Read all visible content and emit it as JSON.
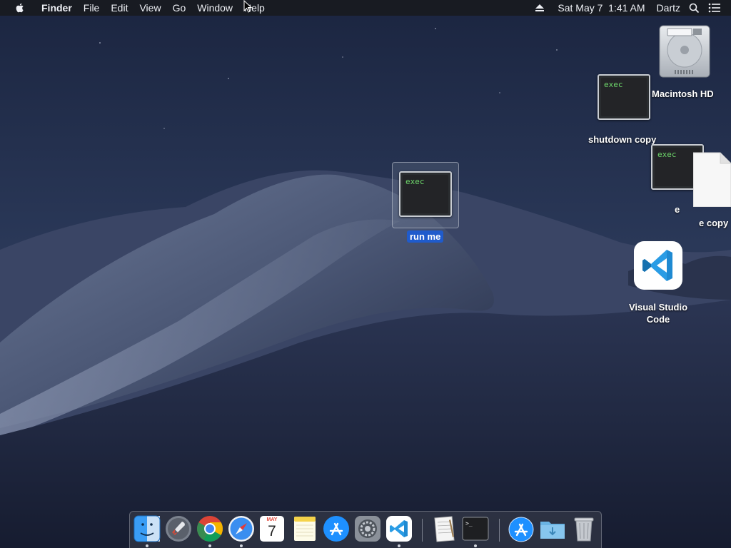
{
  "menubar": {
    "app_name": "Finder",
    "menus": [
      "File",
      "Edit",
      "View",
      "Go",
      "Window",
      "Help"
    ],
    "clock": "Sat May 7  1:41 AM",
    "user": "Dartz",
    "icons": [
      "apple-icon",
      "eject-icon",
      "spotlight-search-icon",
      "notification-center-icon"
    ]
  },
  "desktop": {
    "items": [
      {
        "label": "Macintosh HD",
        "icon": "hard-drive-icon"
      },
      {
        "label": "shutdown copy",
        "icon": "unix-executable-icon",
        "badge": "exec"
      },
      {
        "label": "e",
        "icon": "unix-executable-icon",
        "badge": "exec"
      },
      {
        "label": "e copy",
        "icon": "blank-document-icon"
      },
      {
        "label": "run me",
        "icon": "unix-executable-icon",
        "badge": "exec",
        "selected": true
      },
      {
        "label": "Visual Studio Code",
        "label_lines": [
          "Visual Studio",
          "Code"
        ],
        "icon": "vscode-icon"
      }
    ]
  },
  "dock": {
    "items": [
      {
        "name": "finder-icon",
        "running": true
      },
      {
        "name": "launchpad-icon",
        "running": false
      },
      {
        "name": "chrome-icon",
        "running": true
      },
      {
        "name": "safari-icon",
        "running": true
      },
      {
        "name": "calendar-icon",
        "running": false,
        "month": "MAY",
        "day": "7"
      },
      {
        "name": "notes-icon",
        "running": false
      },
      {
        "name": "app-store-icon",
        "running": false
      },
      {
        "name": "system-preferences-icon",
        "running": false
      },
      {
        "name": "vscode-icon",
        "running": true
      },
      {
        "name": "textedit-icon",
        "running": false
      },
      {
        "name": "terminal-icon",
        "running": true
      },
      {
        "name": "app-store-downloads-icon",
        "running": false
      },
      {
        "name": "downloads-folder-icon",
        "running": false
      },
      {
        "name": "trash-icon",
        "running": false
      }
    ]
  },
  "colors": {
    "selection": "#1f5bcc",
    "exec_text": "#6dd56a",
    "vscode_blue": "#1f8ad2"
  }
}
